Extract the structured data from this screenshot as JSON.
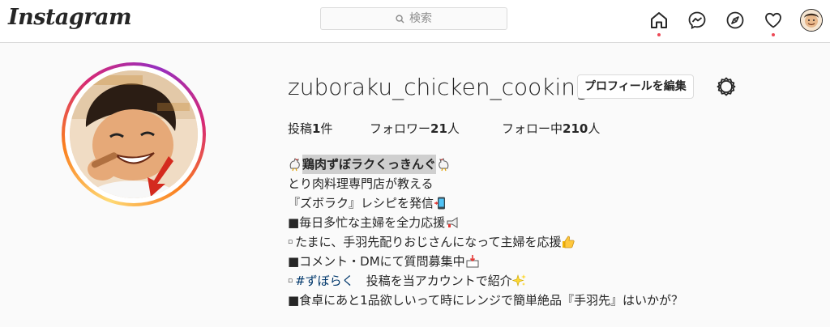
{
  "header": {
    "logo": "Instagram",
    "search_placeholder": "検索"
  },
  "nav": {
    "icons": [
      "home-icon",
      "messenger-icon",
      "explore-icon",
      "heart-icon",
      "avatar"
    ],
    "notification_color": "#ed4956"
  },
  "profile": {
    "username": "zuboraku_chicken_cooking",
    "edit_button": "プロフィールを編集",
    "stats": {
      "posts_label": "投稿",
      "posts_count": "1",
      "posts_unit": "件",
      "followers_label": "フォロワー",
      "followers_count": "21",
      "followers_unit": "人",
      "following_label": "フォロー中",
      "following_count": "210",
      "following_unit": "人"
    },
    "bio": {
      "name": "鶏肉ずぼラクくっきんぐ",
      "line1": "とり肉料理専門店が教える",
      "line2": "『ズボラク』レシピを発信",
      "line3": "■毎日多忙な主婦を全力応援",
      "line4_square": "▫",
      "line4": "たまに、手羽先配りおじさんになって主婦を応援",
      "line5": "■コメント・DMにて質問募集中",
      "line6_square": "▫",
      "line6_tag": "#ずぼらく",
      "line6": "　投稿を当アカウントで紹介",
      "line7": "■食卓にあと1品欲しいって時にレンジで簡単絶品『手羽先』はいかが？"
    }
  }
}
